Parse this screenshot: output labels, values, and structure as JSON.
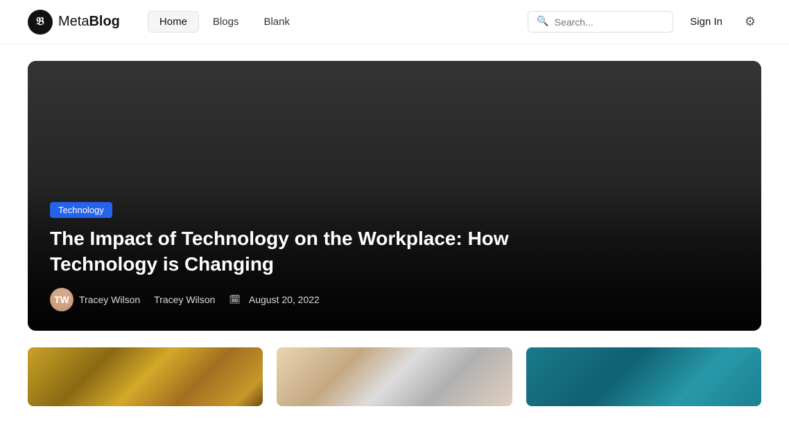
{
  "logo": {
    "icon": "B",
    "name": "MetaBlog"
  },
  "nav": {
    "items": [
      {
        "label": "Home",
        "active": true
      },
      {
        "label": "Blogs",
        "active": false
      },
      {
        "label": "Blank",
        "active": false
      }
    ]
  },
  "search": {
    "placeholder": "Search..."
  },
  "header": {
    "sign_in": "Sign In"
  },
  "hero": {
    "tag": "Technology",
    "title": "The Impact of Technology on the Workplace: How Technology is Changing",
    "author1": "Tracey Wilson",
    "author2": "Tracey Wilson",
    "date_icon": "🗓",
    "date": "August 20, 2022"
  },
  "cards": [
    {
      "id": "crypto",
      "type": "crypto"
    },
    {
      "id": "laptop",
      "type": "laptop"
    },
    {
      "id": "blue",
      "type": "blue"
    }
  ]
}
